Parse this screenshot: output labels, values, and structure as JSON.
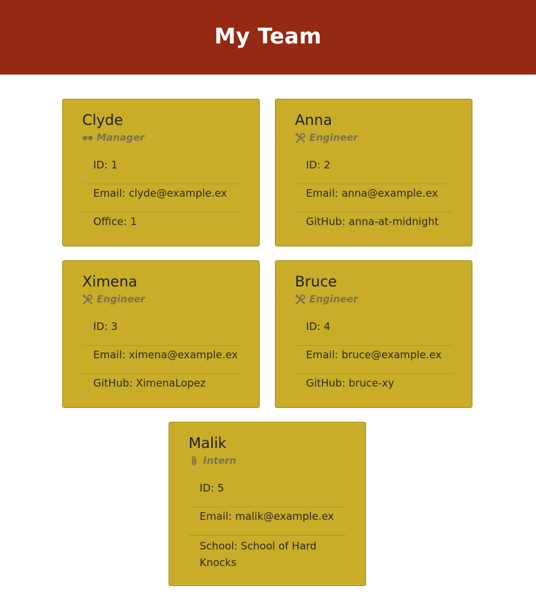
{
  "header": {
    "title": "My Team"
  },
  "colors": {
    "header_bg": "#952912",
    "card_bg": "#c9ac28",
    "role_text": "#7a7350"
  },
  "team": [
    {
      "name": "Clyde",
      "role": "Manager",
      "role_icon": "glasses-icon",
      "id_line": "ID: 1",
      "email_line": "Email: clyde@example.ex",
      "extra_line": "Office: 1"
    },
    {
      "name": "Anna",
      "role": "Engineer",
      "role_icon": "tools-icon",
      "id_line": "ID: 2",
      "email_line": "Email: anna@example.ex",
      "extra_line": "GitHub: anna-at-midnight"
    },
    {
      "name": "Ximena",
      "role": "Engineer",
      "role_icon": "tools-icon",
      "id_line": "ID: 3",
      "email_line": "Email: ximena@example.ex",
      "extra_line": "GitHub: XimenaLopez"
    },
    {
      "name": "Bruce",
      "role": "Engineer",
      "role_icon": "tools-icon",
      "id_line": "ID: 4",
      "email_line": "Email: bruce@example.ex",
      "extra_line": "GitHub: bruce-xy"
    },
    {
      "name": "Malik",
      "role": "Intern",
      "role_icon": "paperclip-icon",
      "id_line": "ID: 5",
      "email_line": "Email: malik@example.ex",
      "extra_line": "School: School of Hard Knocks"
    }
  ]
}
